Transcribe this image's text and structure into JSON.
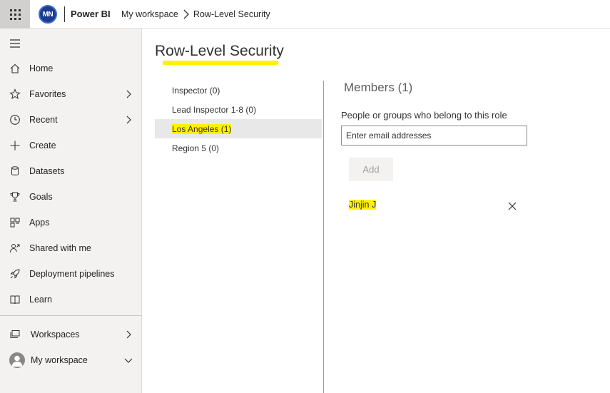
{
  "topbar": {
    "app_launcher_icon": "waffle-icon",
    "account_initials": "MN",
    "product_name": "Power BI",
    "breadcrumb": [
      "My workspace",
      "Row-Level Security"
    ]
  },
  "sidebar": {
    "menu_icon": "hamburger-icon",
    "items": [
      {
        "label": "Home",
        "icon": "home-icon",
        "chevron": false
      },
      {
        "label": "Favorites",
        "icon": "star-icon",
        "chevron": true
      },
      {
        "label": "Recent",
        "icon": "clock-icon",
        "chevron": true
      },
      {
        "label": "Create",
        "icon": "plus-icon",
        "chevron": false
      },
      {
        "label": "Datasets",
        "icon": "database-icon",
        "chevron": false
      },
      {
        "label": "Goals",
        "icon": "trophy-icon",
        "chevron": false
      },
      {
        "label": "Apps",
        "icon": "apps-icon",
        "chevron": false
      },
      {
        "label": "Shared with me",
        "icon": "shared-icon",
        "chevron": false
      },
      {
        "label": "Deployment pipelines",
        "icon": "rocket-icon",
        "chevron": false
      },
      {
        "label": "Learn",
        "icon": "book-icon",
        "chevron": false
      }
    ],
    "workspaces": {
      "label": "Workspaces",
      "icon": "workspaces-icon"
    },
    "my_workspace": {
      "label": "My workspace",
      "icon": "user-avatar"
    }
  },
  "main": {
    "title": "Row-Level Security",
    "roles": [
      {
        "label": "Inspector (0)",
        "selected": false
      },
      {
        "label": "Lead Inspector 1-8 (0)",
        "selected": false
      },
      {
        "label": "Los Angeles (1)",
        "selected": true
      },
      {
        "label": "Region 5 (0)",
        "selected": false
      }
    ],
    "members": {
      "title": "Members (1)",
      "help_text": "People or groups who belong to this role",
      "input_placeholder": "Enter email addresses",
      "input_value": "",
      "add_label": "Add",
      "list": [
        {
          "name": "Jinjin J"
        }
      ]
    }
  },
  "colors": {
    "highlight": "#fff200",
    "sidebar_bg": "#f3f2f1",
    "selected_role_bg": "#e8e8e8",
    "avatar_bg": "#1b3b8c"
  }
}
